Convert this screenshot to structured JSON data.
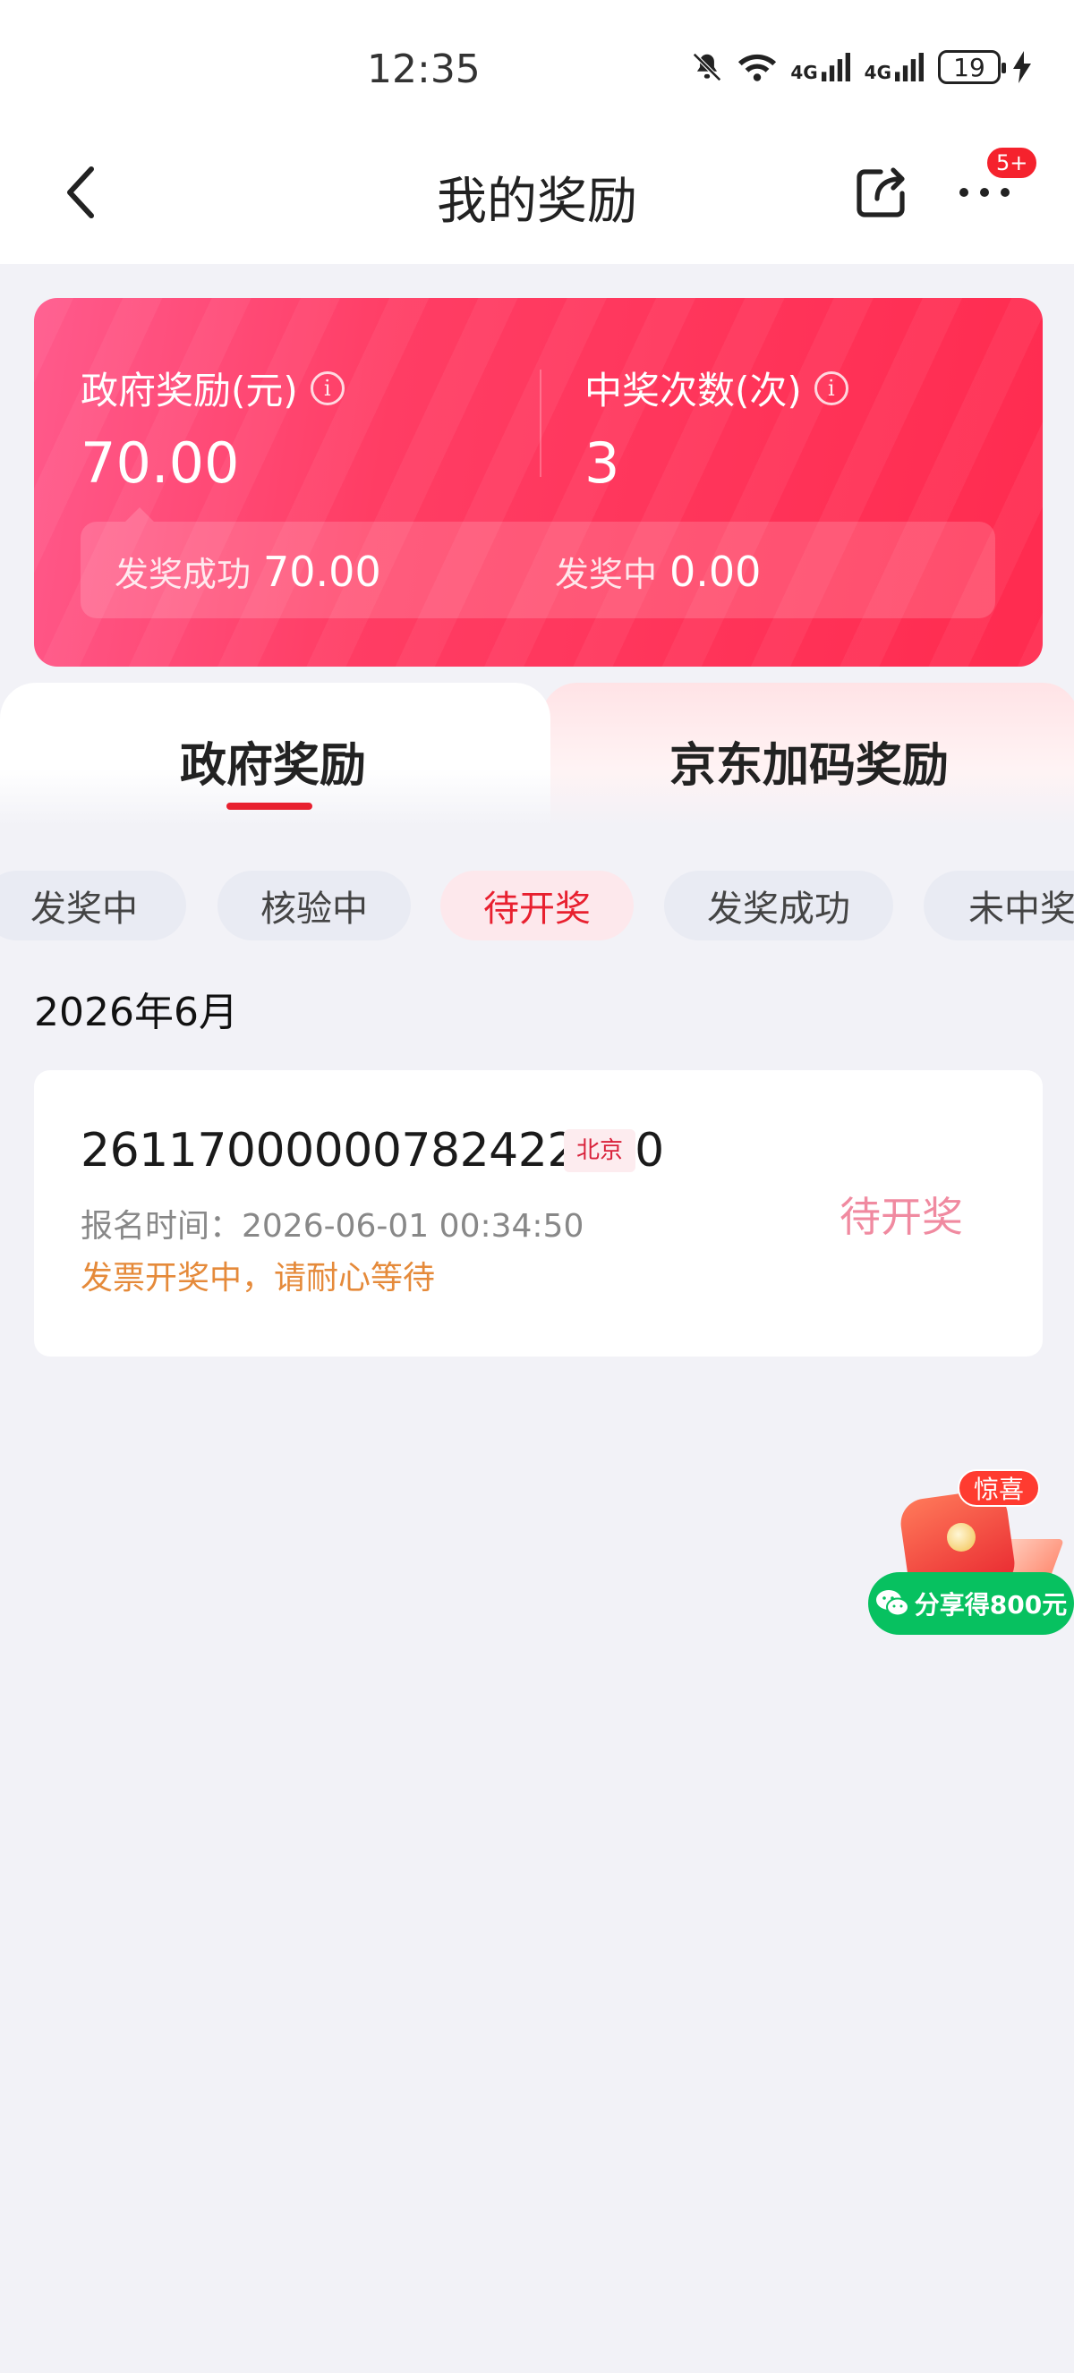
{
  "status_bar": {
    "time": "12:35",
    "network_1": "4G",
    "network_2": "4G",
    "wifi_label": "6",
    "battery": "19"
  },
  "nav": {
    "title": "我的奖励",
    "more_badge": "5+"
  },
  "summary": {
    "gov_reward_label": "政府奖励(元)",
    "gov_reward_value": "70.00",
    "win_count_label": "中奖次数(次)",
    "win_count_value": "3",
    "paid_label": "发奖成功",
    "paid_value": "70.00",
    "paying_label": "发奖中",
    "paying_value": "0.00",
    "colors": {
      "card_start": "#ff5a8c",
      "card_end": "#ff2b4f"
    }
  },
  "main_tabs": [
    {
      "label": "政府奖励",
      "active": true
    },
    {
      "label": "京东加码奖励",
      "active": false
    }
  ],
  "filters": [
    {
      "label": "发奖中",
      "active": false
    },
    {
      "label": "核验中",
      "active": false
    },
    {
      "label": "待开奖",
      "active": true
    },
    {
      "label": "发奖成功",
      "active": false
    },
    {
      "label": "未中奖",
      "active": false
    }
  ],
  "month_label": "2026年6月",
  "records": [
    {
      "id": "26117000000782422110",
      "city": "北京",
      "time": "报名时间：2026-06-01 00:34:50",
      "note": "发票开奖中，请耐心等待",
      "status": "待开奖"
    }
  ],
  "promo": {
    "tag": "惊喜",
    "text": "分享得800元",
    "icon": "wechat-icon",
    "color": "#07c160"
  },
  "accent": "#e8202f"
}
